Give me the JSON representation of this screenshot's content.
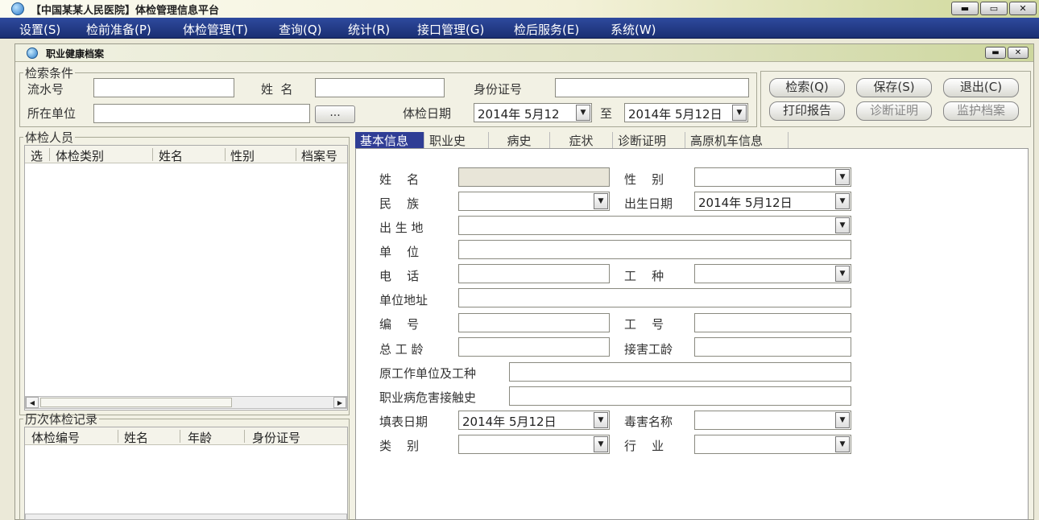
{
  "app": {
    "title": "【中国某某人民医院】体检管理信息平台",
    "icon": "app-icon",
    "window_buttons": [
      "▬",
      "▭",
      "✕"
    ]
  },
  "menu": [
    "设置(S)",
    "检前准备(P)",
    "体检管理(T)",
    "查询(Q)",
    "统计(R)",
    "接口管理(G)",
    "检后服务(E)",
    "系统(W)"
  ],
  "inner_window": {
    "title": "职业健康档案",
    "window_buttons": [
      "▬",
      "✕"
    ]
  },
  "search": {
    "legend": "检索条件",
    "serial_label": "流水号",
    "serial_value": "",
    "name_label": "姓  名",
    "name_value": "",
    "id_label": "身份证号",
    "id_value": "",
    "company_label": "所在单位",
    "company_value": "",
    "company_browse": "...",
    "date_label": "体检日期",
    "date_from": "2014年  5月12",
    "date_to_label": "至",
    "date_to": "2014年  5月12日"
  },
  "actions": {
    "search": "检索(Q)",
    "save": "保存(S)",
    "exit": "退出(C)",
    "print": "打印报告",
    "diagnosis": "诊断证明",
    "monitor": "监护档案"
  },
  "examinees": {
    "legend": "体检人员",
    "columns": [
      "选",
      "体检类别",
      "姓名",
      "性别",
      "档案号"
    ]
  },
  "history": {
    "legend": "历次体检记录",
    "columns": [
      "体检编号",
      "姓名",
      "年龄",
      "身份证号"
    ]
  },
  "tabs": [
    "基本信息",
    "职业史",
    "病史",
    "症状",
    "诊断证明",
    "高原机车信息"
  ],
  "form": {
    "name_label": "姓    名",
    "gender_label": "性    别",
    "ethnicity_label": "民    族",
    "birthdate_label": "出生日期",
    "birthdate_value": "2014年  5月12日",
    "birthplace_label": "出 生 地",
    "unit_label": "单    位",
    "phone_label": "电    话",
    "job_type_label": "工    种",
    "unit_address_label": "单位地址",
    "number_label": "编    号",
    "work_no_label": "工    号",
    "total_years_label": "总 工 龄",
    "exposure_years_label": "接害工龄",
    "prev_job_label": "原工作单位及工种",
    "hazard_history_label": "职业病危害接触史",
    "fill_date_label": "填表日期",
    "fill_date_value": "2014年  5月12日",
    "toxin_label": "毒害名称",
    "category_label": "类    别",
    "industry_label": "行    业"
  }
}
